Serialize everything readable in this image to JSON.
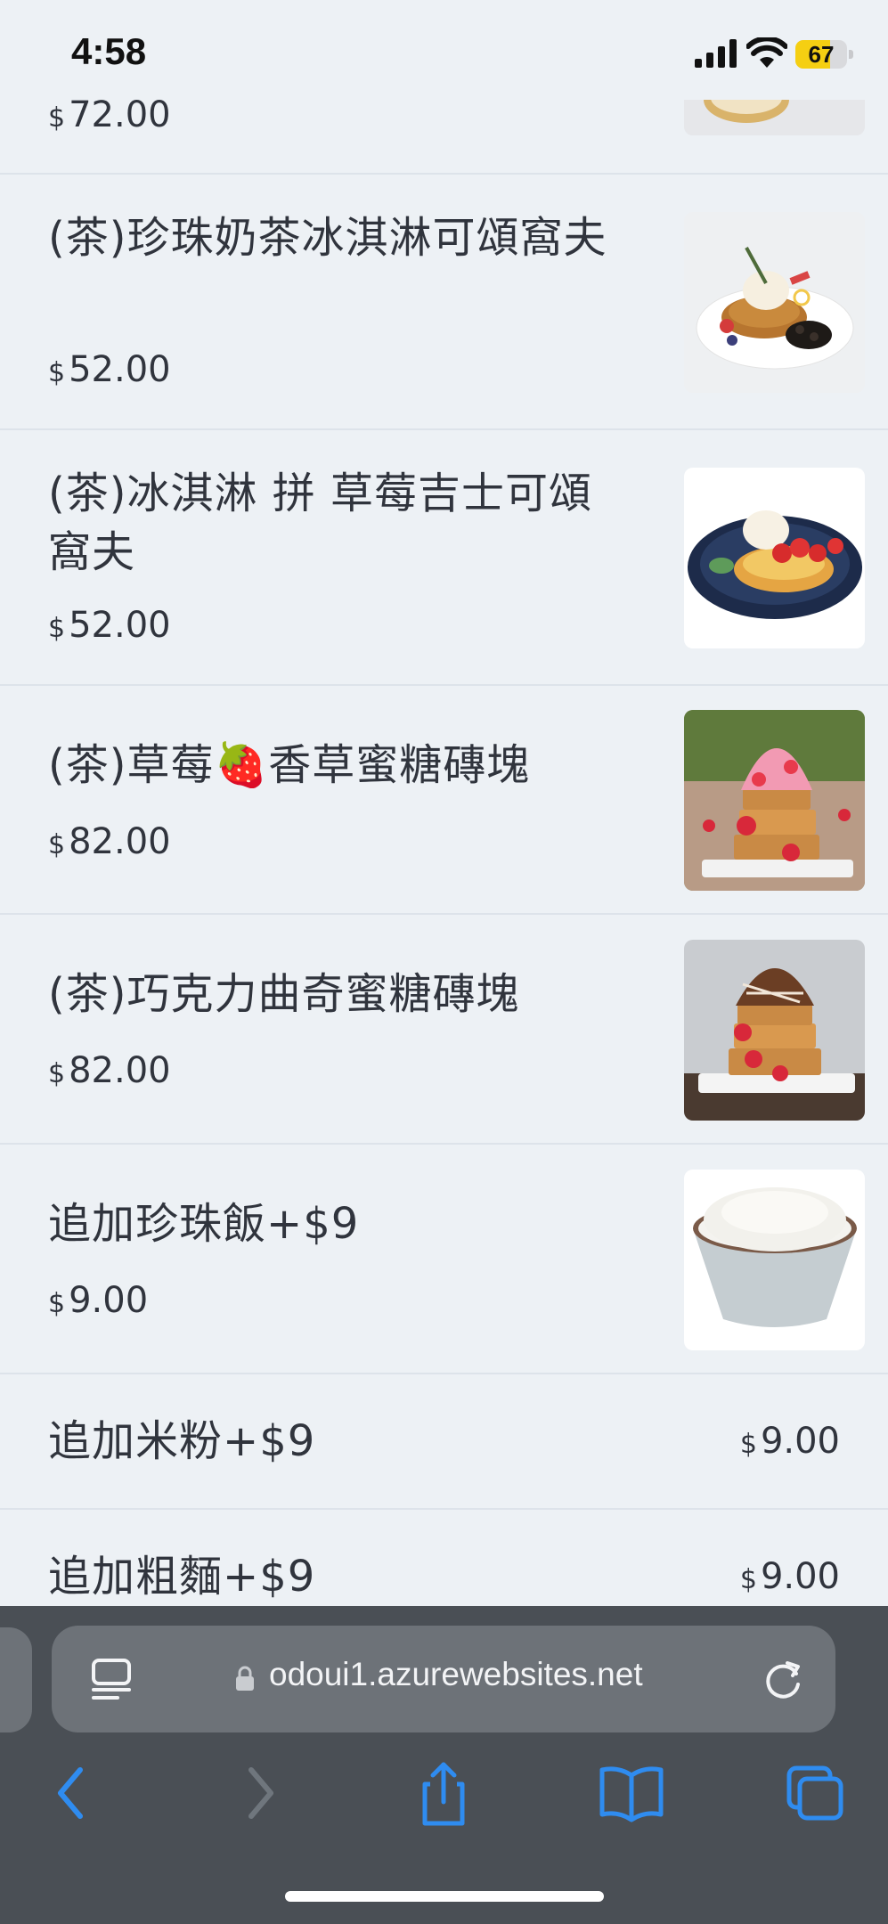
{
  "status_bar": {
    "time": "4:58",
    "battery_level": 67,
    "battery_label": "67"
  },
  "currency_symbol": "$",
  "menu": {
    "top_partial_item": {
      "price": "72.00"
    },
    "items": [
      {
        "name": "(茶)珍珠奶茶冰淇淋可頌窩夫",
        "price": "52.00",
        "image": "pearl-milk-tea-croffle-photo"
      },
      {
        "name": "(茶)冰淇淋 拼 草莓吉士可頌窩夫",
        "price": "52.00",
        "image": "strawberry-custard-croffle-photo"
      },
      {
        "name": "(茶)草莓🍓香草蜜糖磚塊",
        "price": "82.00",
        "image": "strawberry-honey-toast-photo"
      },
      {
        "name": "(茶)巧克力曲奇蜜糖磚塊",
        "price": "82.00",
        "image": "chocolate-honey-toast-photo"
      },
      {
        "name": "追加珍珠飯+$9",
        "price": "9.00",
        "image": "rice-bowl-photo"
      },
      {
        "name": "追加米粉+$9",
        "price": "9.00"
      },
      {
        "name": "追加粗麵+$9",
        "price": "9.00"
      }
    ]
  },
  "browser": {
    "url": "odoui1.azurewebsites.net",
    "icons": {
      "reader": "reader-mode-icon",
      "lock": "lock-icon",
      "reload": "reload-icon",
      "back": "chevron-left-icon",
      "forward": "chevron-right-icon",
      "share": "share-icon",
      "bookmarks": "book-icon",
      "tabs": "tabs-icon"
    },
    "accent_color": "#2f8cf0"
  }
}
